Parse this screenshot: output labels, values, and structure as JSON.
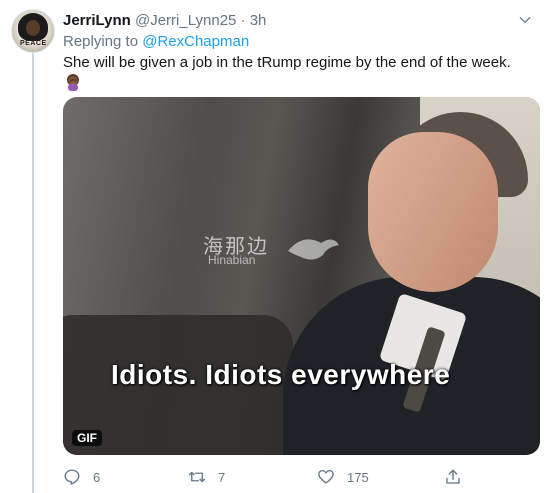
{
  "tweet": {
    "display_name": "JerriLynn",
    "handle": "@Jerri_Lynn25",
    "separator": "·",
    "time": "3h",
    "replying_prefix": "Replying to ",
    "replying_to": "@RexChapman",
    "text": "She will be given a job in the tRump regime by the end of the week.",
    "emoji": "woman-facepalming-emoji",
    "avatar_tag": "PEACE"
  },
  "media": {
    "watermark_cn": "海那边",
    "watermark_en": "Hinabian",
    "caption": "Idiots. Idiots everywhere",
    "badge": "GIF"
  },
  "actions": {
    "replies": "6",
    "retweets": "7",
    "likes": "175"
  },
  "colors": {
    "link": "#1da1f2",
    "muted": "#657786",
    "text": "#14171a"
  }
}
